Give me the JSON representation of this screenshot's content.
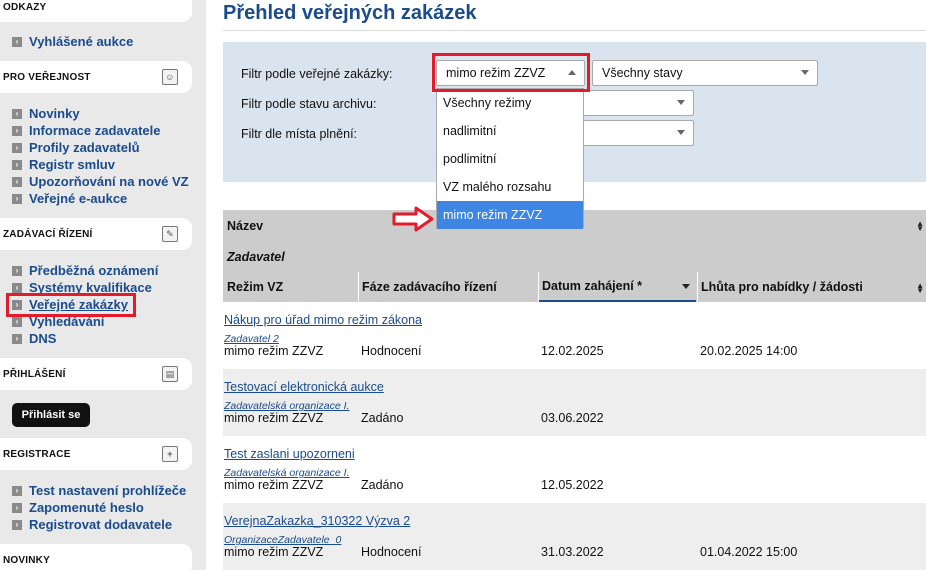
{
  "sidebar": {
    "sections": {
      "odkazy": {
        "title": "ODKAZY"
      },
      "verejnost": {
        "title": "PRO VEŘEJNOST"
      },
      "rizeni": {
        "title": "ZADÁVACÍ ŘÍZENÍ"
      },
      "prihlaseni": {
        "title": "PŘIHLÁŠENÍ"
      },
      "registrace": {
        "title": "REGISTRACE"
      },
      "novinky": {
        "title": "NOVINKY"
      }
    },
    "odkazy_items": [
      "Vyhlášené aukce"
    ],
    "verejnost_items": [
      "Novinky",
      "Informace zadavatele",
      "Profily zadavatelů",
      "Registr smluv",
      "Upozorňování na nové VZ",
      "Veřejné e-aukce"
    ],
    "rizeni_items": [
      "Předběžná oznámení",
      "Systémy kvalifikace",
      "Veřejné zakázky",
      "Vyhledávání",
      "DNS"
    ],
    "login_button": "Přihlásit se",
    "registrace_items": [
      "Test nastavení prohlížeče",
      "Zapomenuté heslo",
      "Registrovat dodavatele"
    ]
  },
  "main": {
    "title": "Přehled veřejných zakázek",
    "filters": {
      "label_regime": "Filtr podle veřejné zakázky:",
      "label_archive": "Filtr podle stavu archivu:",
      "label_place": "Filtr dle místa plnění:",
      "regime_value": "mimo režim ZZVZ",
      "state_value": "Všechny stavy",
      "regime_options": [
        "Všechny režimy",
        "nadlimitní",
        "podlimitní",
        "VZ malého rozsahu",
        "mimo režim ZZVZ"
      ]
    },
    "table": {
      "header_name": "Název",
      "header_zadavatel": "Zadavatel",
      "columns": [
        "Režim VZ",
        "Fáze zadávacího řízení",
        "Datum zahájení *",
        "Lhůta pro nabídky / žádosti"
      ],
      "rows": [
        {
          "name": "Nákup pro úřad mimo režim zákona",
          "zadavatel": "Zadavatel 2",
          "regime": "mimo režim ZZVZ",
          "phase": "Hodnocení",
          "start": "12.02.2025",
          "deadline": "20.02.2025 14:00"
        },
        {
          "name": "Testovací elektronická aukce",
          "zadavatel": "Zadavatelská organizace I.",
          "regime": "mimo režim ZZVZ",
          "phase": "Zadáno",
          "start": "03.06.2022",
          "deadline": ""
        },
        {
          "name": "Test zaslani upozorneni",
          "zadavatel": "Zadavatelská organizace I.",
          "regime": "mimo režim ZZVZ",
          "phase": "Zadáno",
          "start": "12.05.2022",
          "deadline": ""
        },
        {
          "name": "VerejnaZakazka_310322 Výzva 2",
          "zadavatel": "OrganizaceZadavatele_0",
          "regime": "mimo režim ZZVZ",
          "phase": "Hodnocení",
          "start": "31.03.2022",
          "deadline": "01.04.2022 15:00"
        }
      ]
    }
  },
  "colors": {
    "accent": "#1a4b8c",
    "highlight": "#e21c2a",
    "selected_option": "#3d86e4",
    "filter_panel": "#d9e4ee"
  }
}
